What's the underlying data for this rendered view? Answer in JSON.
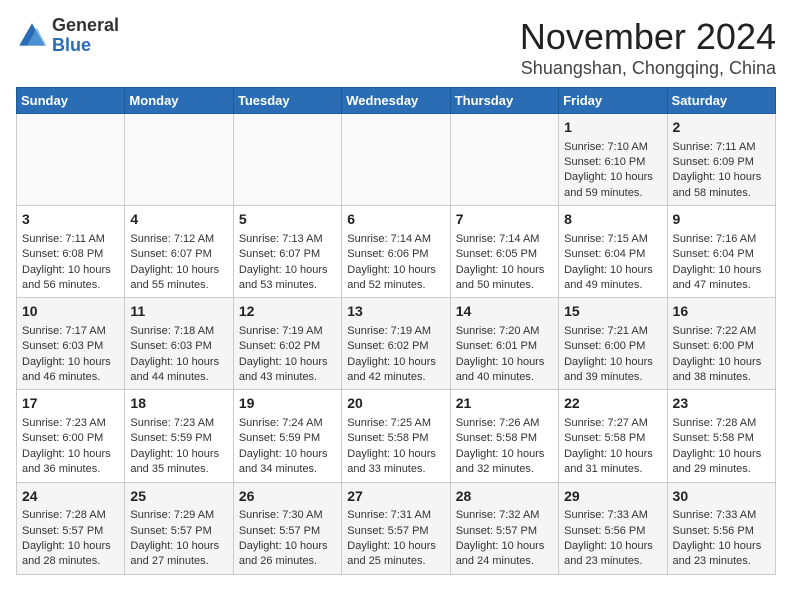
{
  "header": {
    "logo_general": "General",
    "logo_blue": "Blue",
    "month_title": "November 2024",
    "location": "Shuangshan, Chongqing, China"
  },
  "weekdays": [
    "Sunday",
    "Monday",
    "Tuesday",
    "Wednesday",
    "Thursday",
    "Friday",
    "Saturday"
  ],
  "weeks": [
    [
      {
        "day": "",
        "info": ""
      },
      {
        "day": "",
        "info": ""
      },
      {
        "day": "",
        "info": ""
      },
      {
        "day": "",
        "info": ""
      },
      {
        "day": "",
        "info": ""
      },
      {
        "day": "1",
        "info": "Sunrise: 7:10 AM\nSunset: 6:10 PM\nDaylight: 10 hours and 59 minutes."
      },
      {
        "day": "2",
        "info": "Sunrise: 7:11 AM\nSunset: 6:09 PM\nDaylight: 10 hours and 58 minutes."
      }
    ],
    [
      {
        "day": "3",
        "info": "Sunrise: 7:11 AM\nSunset: 6:08 PM\nDaylight: 10 hours and 56 minutes."
      },
      {
        "day": "4",
        "info": "Sunrise: 7:12 AM\nSunset: 6:07 PM\nDaylight: 10 hours and 55 minutes."
      },
      {
        "day": "5",
        "info": "Sunrise: 7:13 AM\nSunset: 6:07 PM\nDaylight: 10 hours and 53 minutes."
      },
      {
        "day": "6",
        "info": "Sunrise: 7:14 AM\nSunset: 6:06 PM\nDaylight: 10 hours and 52 minutes."
      },
      {
        "day": "7",
        "info": "Sunrise: 7:14 AM\nSunset: 6:05 PM\nDaylight: 10 hours and 50 minutes."
      },
      {
        "day": "8",
        "info": "Sunrise: 7:15 AM\nSunset: 6:04 PM\nDaylight: 10 hours and 49 minutes."
      },
      {
        "day": "9",
        "info": "Sunrise: 7:16 AM\nSunset: 6:04 PM\nDaylight: 10 hours and 47 minutes."
      }
    ],
    [
      {
        "day": "10",
        "info": "Sunrise: 7:17 AM\nSunset: 6:03 PM\nDaylight: 10 hours and 46 minutes."
      },
      {
        "day": "11",
        "info": "Sunrise: 7:18 AM\nSunset: 6:03 PM\nDaylight: 10 hours and 44 minutes."
      },
      {
        "day": "12",
        "info": "Sunrise: 7:19 AM\nSunset: 6:02 PM\nDaylight: 10 hours and 43 minutes."
      },
      {
        "day": "13",
        "info": "Sunrise: 7:19 AM\nSunset: 6:02 PM\nDaylight: 10 hours and 42 minutes."
      },
      {
        "day": "14",
        "info": "Sunrise: 7:20 AM\nSunset: 6:01 PM\nDaylight: 10 hours and 40 minutes."
      },
      {
        "day": "15",
        "info": "Sunrise: 7:21 AM\nSunset: 6:00 PM\nDaylight: 10 hours and 39 minutes."
      },
      {
        "day": "16",
        "info": "Sunrise: 7:22 AM\nSunset: 6:00 PM\nDaylight: 10 hours and 38 minutes."
      }
    ],
    [
      {
        "day": "17",
        "info": "Sunrise: 7:23 AM\nSunset: 6:00 PM\nDaylight: 10 hours and 36 minutes."
      },
      {
        "day": "18",
        "info": "Sunrise: 7:23 AM\nSunset: 5:59 PM\nDaylight: 10 hours and 35 minutes."
      },
      {
        "day": "19",
        "info": "Sunrise: 7:24 AM\nSunset: 5:59 PM\nDaylight: 10 hours and 34 minutes."
      },
      {
        "day": "20",
        "info": "Sunrise: 7:25 AM\nSunset: 5:58 PM\nDaylight: 10 hours and 33 minutes."
      },
      {
        "day": "21",
        "info": "Sunrise: 7:26 AM\nSunset: 5:58 PM\nDaylight: 10 hours and 32 minutes."
      },
      {
        "day": "22",
        "info": "Sunrise: 7:27 AM\nSunset: 5:58 PM\nDaylight: 10 hours and 31 minutes."
      },
      {
        "day": "23",
        "info": "Sunrise: 7:28 AM\nSunset: 5:58 PM\nDaylight: 10 hours and 29 minutes."
      }
    ],
    [
      {
        "day": "24",
        "info": "Sunrise: 7:28 AM\nSunset: 5:57 PM\nDaylight: 10 hours and 28 minutes."
      },
      {
        "day": "25",
        "info": "Sunrise: 7:29 AM\nSunset: 5:57 PM\nDaylight: 10 hours and 27 minutes."
      },
      {
        "day": "26",
        "info": "Sunrise: 7:30 AM\nSunset: 5:57 PM\nDaylight: 10 hours and 26 minutes."
      },
      {
        "day": "27",
        "info": "Sunrise: 7:31 AM\nSunset: 5:57 PM\nDaylight: 10 hours and 25 minutes."
      },
      {
        "day": "28",
        "info": "Sunrise: 7:32 AM\nSunset: 5:57 PM\nDaylight: 10 hours and 24 minutes."
      },
      {
        "day": "29",
        "info": "Sunrise: 7:33 AM\nSunset: 5:56 PM\nDaylight: 10 hours and 23 minutes."
      },
      {
        "day": "30",
        "info": "Sunrise: 7:33 AM\nSunset: 5:56 PM\nDaylight: 10 hours and 23 minutes."
      }
    ]
  ]
}
